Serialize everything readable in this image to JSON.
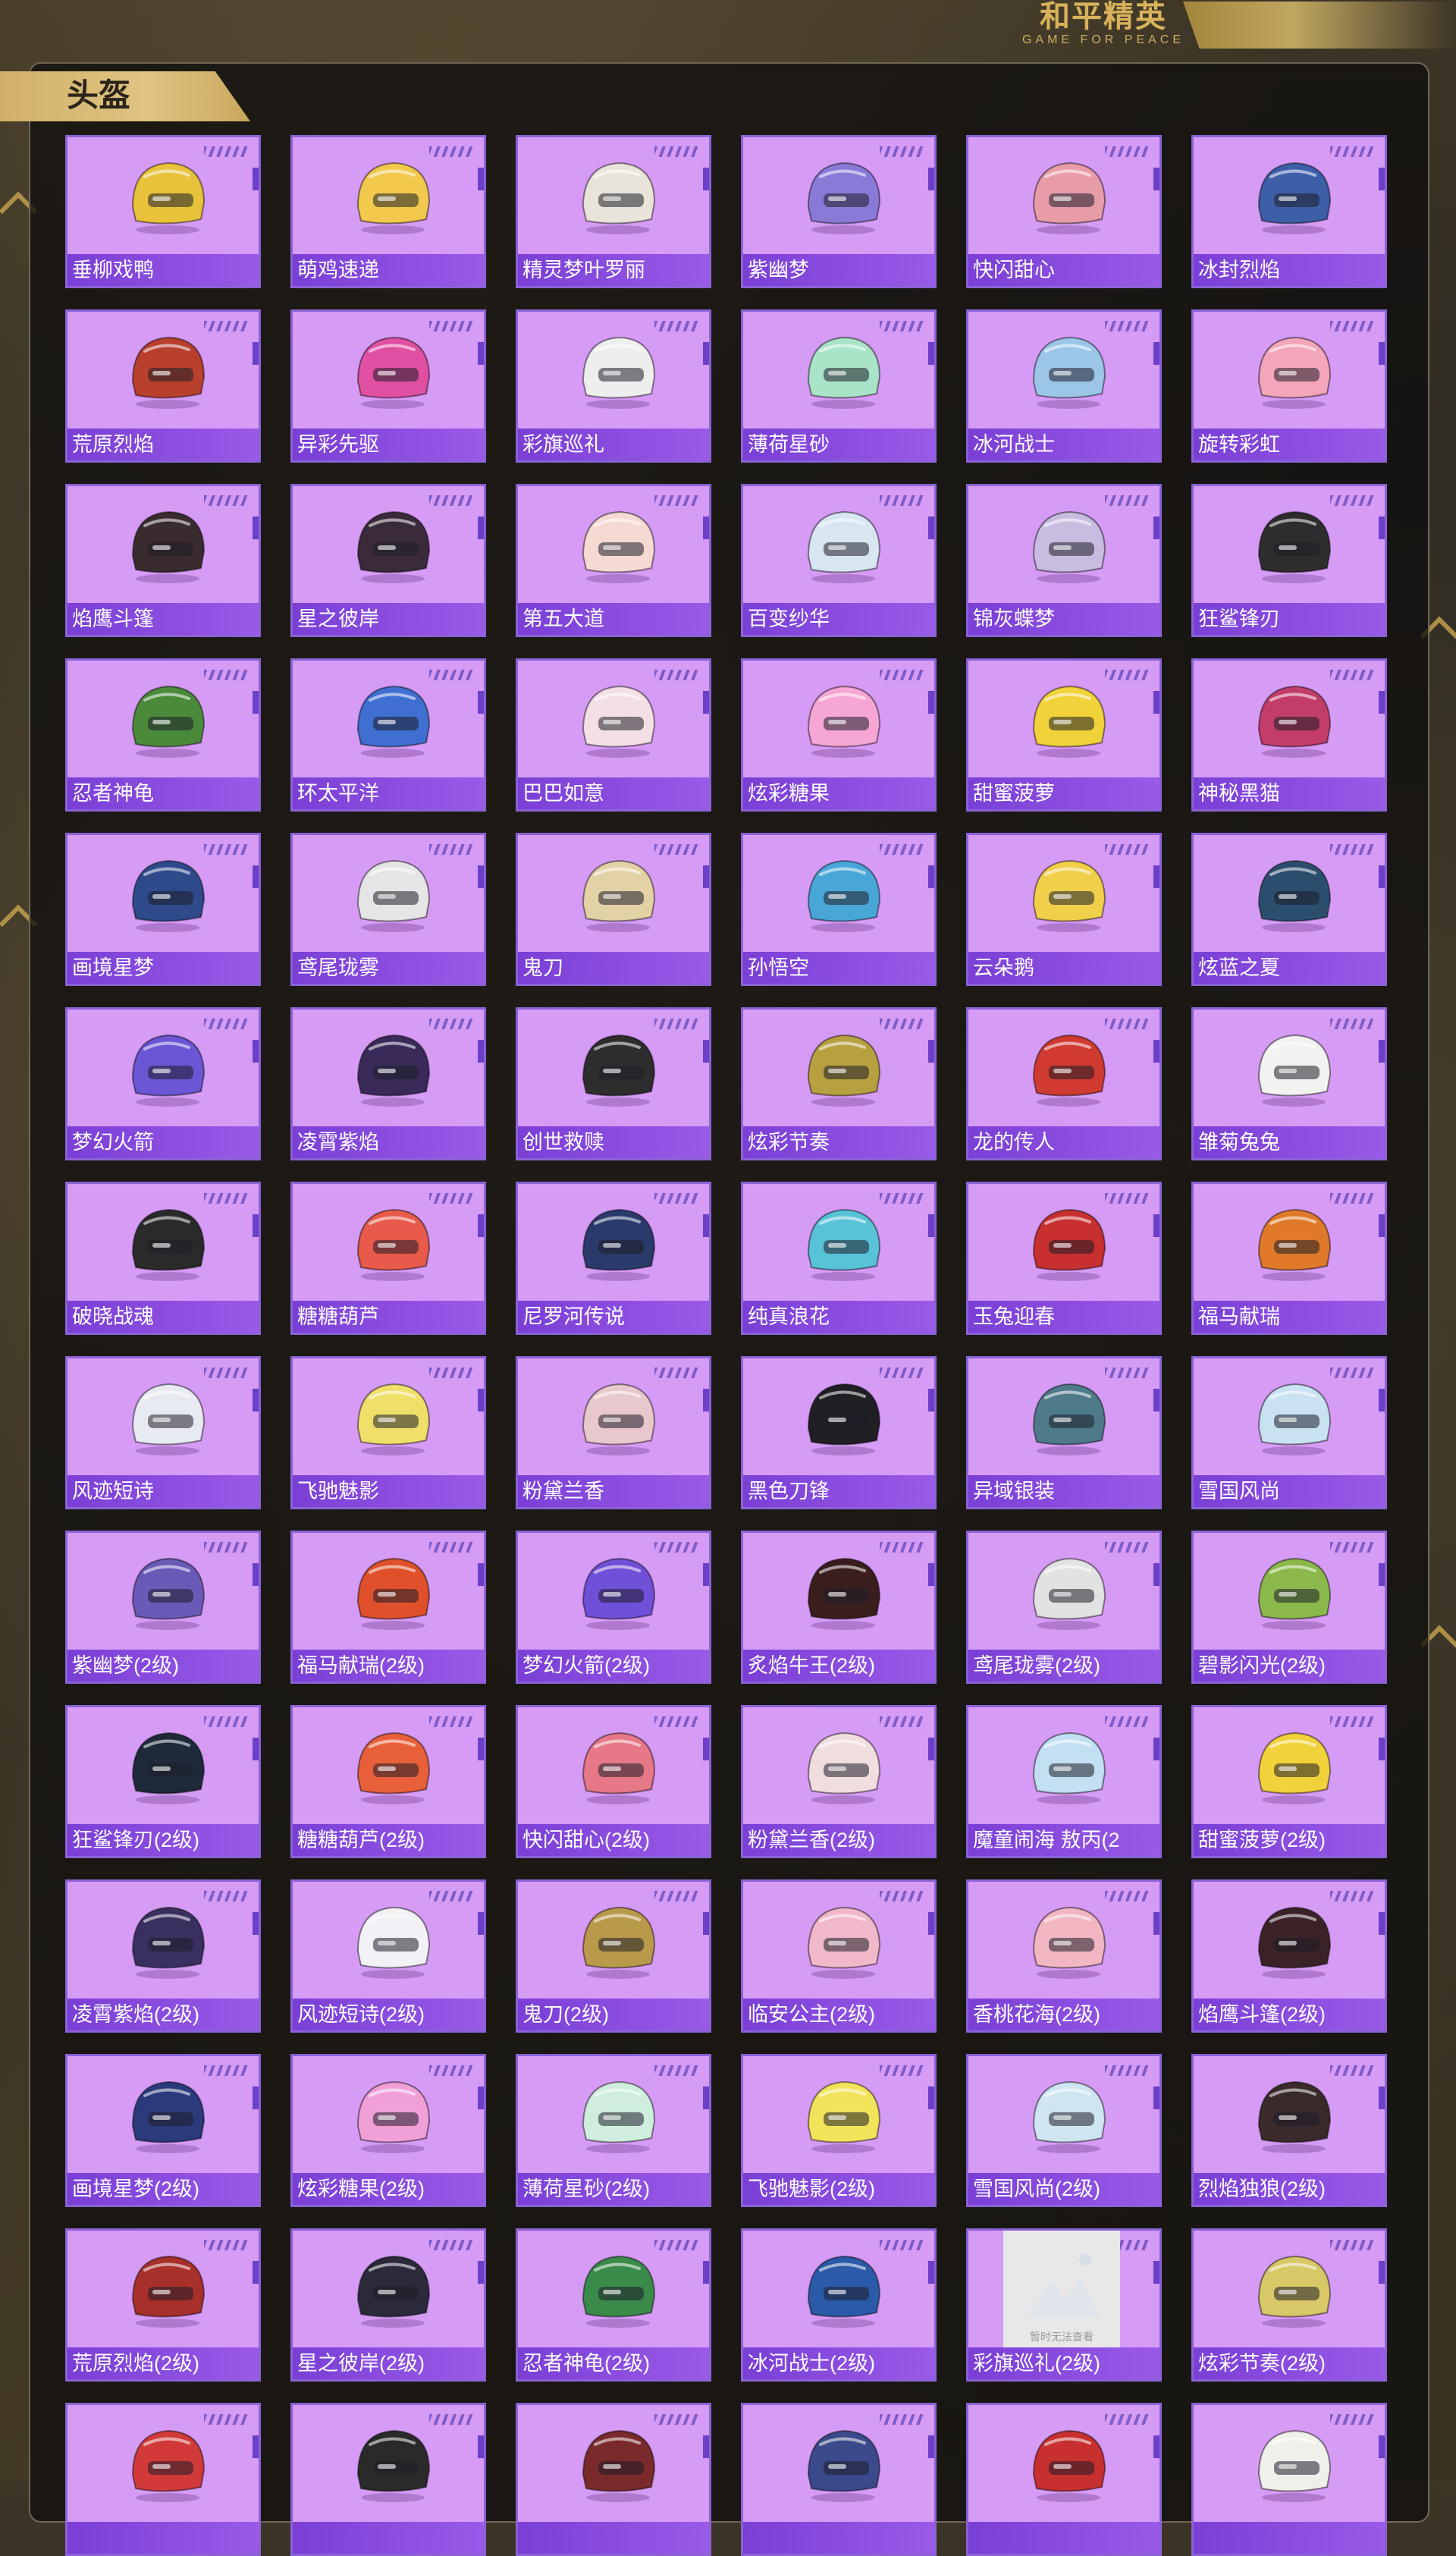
{
  "brand": {
    "name_cn": "和平精英",
    "name_en": "GAME FOR PEACE"
  },
  "section": {
    "title": "头盔"
  },
  "placeholder_caption": "暂时无法查看",
  "items": [
    {
      "name": "垂柳戏鸭",
      "color": "#e8c23a"
    },
    {
      "name": "萌鸡速递",
      "color": "#f2c94c"
    },
    {
      "name": "精灵梦叶罗丽",
      "color": "#e9e4da"
    },
    {
      "name": "紫幽梦",
      "color": "#8a7ad8"
    },
    {
      "name": "快闪甜心",
      "color": "#e79ca8"
    },
    {
      "name": "冰封烈焰",
      "color": "#3d5fa8"
    },
    {
      "name": "荒原烈焰",
      "color": "#b8402d"
    },
    {
      "name": "异彩先驱",
      "color": "#e04fa2"
    },
    {
      "name": "彩旗巡礼",
      "color": "#eeeeee"
    },
    {
      "name": "薄荷星砂",
      "color": "#a9e3c8"
    },
    {
      "name": "冰河战士",
      "color": "#9cc6e8"
    },
    {
      "name": "旋转彩虹",
      "color": "#f3a5b9"
    },
    {
      "name": "焰鹰斗篷",
      "color": "#3a2b2e"
    },
    {
      "name": "星之彼岸",
      "color": "#3a2a3a"
    },
    {
      "name": "第五大道",
      "color": "#f5d9d2"
    },
    {
      "name": "百变纱华",
      "color": "#d8e6f2"
    },
    {
      "name": "锦灰蝶梦",
      "color": "#c8bde0"
    },
    {
      "name": "狂鲨锋刃",
      "color": "#2d2d2d"
    },
    {
      "name": "忍者神龟",
      "color": "#4a8a3a"
    },
    {
      "name": "环太平洋",
      "color": "#3f6fd0"
    },
    {
      "name": "巴巴如意",
      "color": "#f3dfe4"
    },
    {
      "name": "炫彩糖果",
      "color": "#f6a6d4"
    },
    {
      "name": "甜蜜菠萝",
      "color": "#f0d23a"
    },
    {
      "name": "神秘黑猫",
      "color": "#c23d6a"
    },
    {
      "name": "画境星梦",
      "color": "#2e4a8a"
    },
    {
      "name": "鸢尾珑雾",
      "color": "#e5e5e5"
    },
    {
      "name": "鬼刀",
      "color": "#e3d2a6"
    },
    {
      "name": "孙悟空",
      "color": "#49a7d8"
    },
    {
      "name": "云朵鹅",
      "color": "#f0d04a"
    },
    {
      "name": "炫蓝之夏",
      "color": "#2c4e6e"
    },
    {
      "name": "梦幻火箭",
      "color": "#6b56d6"
    },
    {
      "name": "凌霄紫焰",
      "color": "#3a2a5a"
    },
    {
      "name": "创世救赎",
      "color": "#2d2d2d"
    },
    {
      "name": "炫彩节奏",
      "color": "#b7a040"
    },
    {
      "name": "龙的传人",
      "color": "#d03a30"
    },
    {
      "name": "雏菊兔兔",
      "color": "#f2f2f0"
    },
    {
      "name": "破晓战魂",
      "color": "#2a2a2a"
    },
    {
      "name": "糖糖葫芦",
      "color": "#e85a4a"
    },
    {
      "name": "尼罗河传说",
      "color": "#2a3a6a"
    },
    {
      "name": "纯真浪花",
      "color": "#58c2d6"
    },
    {
      "name": "玉兔迎春",
      "color": "#c83030"
    },
    {
      "name": "福马献瑞",
      "color": "#e07a2a"
    },
    {
      "name": "风迹短诗",
      "color": "#e8eaf2"
    },
    {
      "name": "飞驰魅影",
      "color": "#f0e06a"
    },
    {
      "name": "粉黛兰香",
      "color": "#e8c8cc"
    },
    {
      "name": "黑色刀锋",
      "color": "#1f1f24"
    },
    {
      "name": "异域银装",
      "color": "#4e7a8a"
    },
    {
      "name": "雪国风尚",
      "color": "#c8e2f2"
    },
    {
      "name": "紫幽梦(2级)",
      "color": "#6a5ab8"
    },
    {
      "name": "福马献瑞(2级)",
      "color": "#e0502a"
    },
    {
      "name": "梦幻火箭(2级)",
      "color": "#7050d8"
    },
    {
      "name": "炙焰牛王(2级)",
      "color": "#3a1e1e"
    },
    {
      "name": "鸢尾珑雾(2级)",
      "color": "#e2e2e2"
    },
    {
      "name": "碧影闪光(2级)",
      "color": "#8ab84a"
    },
    {
      "name": "狂鲨锋刃(2级)",
      "color": "#1e2a3a"
    },
    {
      "name": "糖糖葫芦(2级)",
      "color": "#e8603a"
    },
    {
      "name": "快闪甜心(2级)",
      "color": "#e67888"
    },
    {
      "name": "粉黛兰香(2级)",
      "color": "#f0dede"
    },
    {
      "name": "魔童闹海 敖丙(2",
      "color": "#c2e0f2"
    },
    {
      "name": "甜蜜菠萝(2级)",
      "color": "#f2d23a"
    },
    {
      "name": "凌霄紫焰(2级)",
      "color": "#3a3060"
    },
    {
      "name": "风迹短诗(2级)",
      "color": "#f2f2f6"
    },
    {
      "name": "鬼刀(2级)",
      "color": "#b89a4a"
    },
    {
      "name": "临安公主(2级)",
      "color": "#f0b8c8"
    },
    {
      "name": "香桃花海(2级)",
      "color": "#f2b6c2"
    },
    {
      "name": "焰鹰斗篷(2级)",
      "color": "#3a2226"
    },
    {
      "name": "画境星梦(2级)",
      "color": "#2a3a7a"
    },
    {
      "name": "炫彩糖果(2级)",
      "color": "#f0a0d6"
    },
    {
      "name": "薄荷星砂(2级)",
      "color": "#cfeedd"
    },
    {
      "name": "飞驰魅影(2级)",
      "color": "#f2e45a"
    },
    {
      "name": "雪国风尚(2级)",
      "color": "#cfe6f2"
    },
    {
      "name": "烈焰独狼(2级)",
      "color": "#3a2a2a"
    },
    {
      "name": "荒原烈焰(2级)",
      "color": "#a8302a"
    },
    {
      "name": "星之彼岸(2级)",
      "color": "#2a2a3a"
    },
    {
      "name": "忍者神龟(2级)",
      "color": "#3a8a4a"
    },
    {
      "name": "冰河战士(2级)",
      "color": "#2a5aa8"
    },
    {
      "name": "彩旗巡礼(2级)",
      "color": "",
      "placeholder": true
    },
    {
      "name": "炫彩节奏(2级)",
      "color": "#d8c868"
    },
    {
      "name": "",
      "color": "#d23a3a"
    },
    {
      "name": "",
      "color": "#2a2a2a"
    },
    {
      "name": "",
      "color": "#7a2a2a"
    },
    {
      "name": "",
      "color": "#3a4a8a"
    },
    {
      "name": "",
      "color": "#c83030"
    },
    {
      "name": "",
      "color": "#f0f0ea"
    }
  ]
}
